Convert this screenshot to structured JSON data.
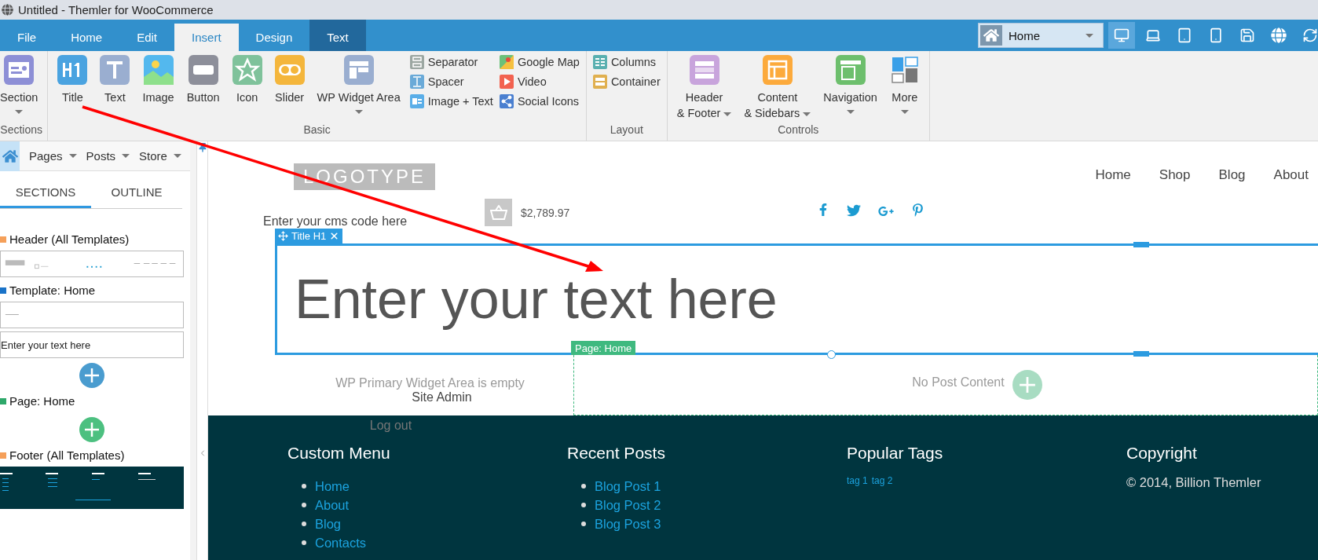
{
  "window": {
    "title": "Untitled - Themler for WooCommerce"
  },
  "menu_tabs": [
    {
      "label": "File",
      "selected": false,
      "contextual": false
    },
    {
      "label": "Home",
      "selected": false,
      "contextual": false
    },
    {
      "label": "Edit",
      "selected": false,
      "contextual": false
    },
    {
      "label": "Insert",
      "selected": true,
      "contextual": false
    },
    {
      "label": "Design",
      "selected": false,
      "contextual": false
    },
    {
      "label": "Text",
      "selected": false,
      "contextual": true
    }
  ],
  "page_select": {
    "value": "Home"
  },
  "device_views": [
    {
      "selected": true
    },
    {
      "selected": false
    },
    {
      "selected": false
    },
    {
      "selected": false
    }
  ],
  "ribbon_groups": [
    {
      "label": "Sections",
      "items": [
        {
          "kind": "large",
          "lines": [
            "Section"
          ],
          "dropdown": true
        }
      ]
    },
    {
      "label": "Basic",
      "items": [
        {
          "kind": "large",
          "lines": [
            "Title"
          ],
          "dropdown": false
        },
        {
          "kind": "large",
          "lines": [
            "Text"
          ],
          "dropdown": false
        },
        {
          "kind": "large",
          "lines": [
            "Image"
          ],
          "dropdown": false
        },
        {
          "kind": "large",
          "lines": [
            "Button"
          ],
          "dropdown": false
        },
        {
          "kind": "large",
          "lines": [
            "Icon"
          ],
          "dropdown": false
        },
        {
          "kind": "large",
          "lines": [
            "Slider"
          ],
          "dropdown": false
        },
        {
          "kind": "large",
          "lines": [
            "WP Widget Area"
          ],
          "dropdown": true
        },
        {
          "kind": "stack",
          "entries": [
            "Separator",
            "Spacer",
            "Image + Text"
          ]
        },
        {
          "kind": "stack",
          "entries": [
            "Google Map",
            "Video",
            "Social Icons"
          ]
        }
      ]
    },
    {
      "label": "Layout",
      "items": [
        {
          "kind": "stack",
          "entries": [
            "Columns",
            "Container"
          ]
        }
      ]
    },
    {
      "label": "Controls",
      "items": [
        {
          "kind": "large",
          "lines": [
            "Header",
            "& Footer"
          ],
          "dropdown": true
        },
        {
          "kind": "large",
          "lines": [
            "Content",
            "& Sidebars"
          ],
          "dropdown": true
        },
        {
          "kind": "large",
          "lines": [
            "Navigation"
          ],
          "dropdown": true
        },
        {
          "kind": "large",
          "lines": [
            "More"
          ],
          "dropdown": true
        }
      ]
    }
  ],
  "sidebar": {
    "nav": [
      {
        "label": "Pages"
      },
      {
        "label": "Posts"
      },
      {
        "label": "Store"
      }
    ],
    "tabs": [
      {
        "label": "SECTIONS",
        "selected": true
      },
      {
        "label": "OUTLINE",
        "selected": false
      }
    ],
    "sections": [
      {
        "kind": "heading",
        "label": "Header (All Templates)",
        "color": "#f5a05a"
      },
      {
        "kind": "header-thumbnail"
      },
      {
        "kind": "heading",
        "label": "Template: Home",
        "color": "#1a73c8"
      },
      {
        "kind": "template-thumbnail"
      },
      {
        "kind": "text-box",
        "text": "Enter your text here"
      },
      {
        "kind": "add-button",
        "color": "#4a9ccf"
      },
      {
        "kind": "heading",
        "label": "Page: Home",
        "color": "#2ea86a"
      },
      {
        "kind": "add-button",
        "color": "#4cc080"
      },
      {
        "kind": "heading",
        "label": "Footer (All Templates)",
        "color": "#f5a05a"
      },
      {
        "kind": "footer-thumbnail"
      }
    ]
  },
  "canvas": {
    "logo": "LOGOTYPE",
    "cms_text": "Enter your cms code here",
    "cart_total": "$2,789.97",
    "nav": [
      "Home",
      "Shop",
      "Blog",
      "About"
    ],
    "title_block": {
      "label": "Title H1",
      "text": "Enter your text here",
      "selected": true
    },
    "page_tag": "Page: Home",
    "widget_area": {
      "empty_text": "WP Primary Widget Area is empty",
      "links": [
        "Site Admin",
        "Log out"
      ]
    },
    "post_content": "No Post Content",
    "footer": [
      {
        "kind": "links",
        "heading": "Custom Menu",
        "items": [
          "Home",
          "About",
          "Blog",
          "Contacts"
        ]
      },
      {
        "kind": "links",
        "heading": "Recent Posts",
        "items": [
          "Blog Post 1",
          "Blog Post 2",
          "Blog Post 3"
        ]
      },
      {
        "kind": "tags",
        "heading": "Popular Tags",
        "items": [
          "tag 1",
          "tag 2"
        ]
      },
      {
        "kind": "text",
        "heading": "Copyright",
        "text": "© 2014, Billion Themler"
      }
    ]
  }
}
